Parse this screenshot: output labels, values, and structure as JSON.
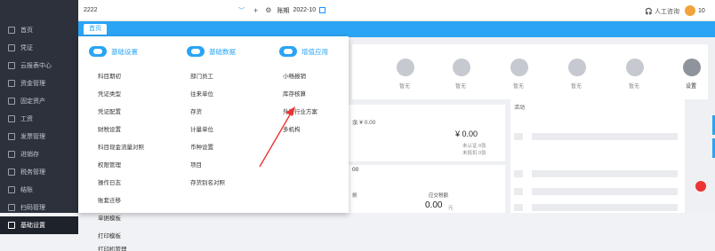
{
  "sidebar": {
    "items": [
      {
        "label": "首页"
      },
      {
        "label": "凭证"
      },
      {
        "label": "云报表中心"
      },
      {
        "label": "资金管理"
      },
      {
        "label": "固定资产"
      },
      {
        "label": "工资"
      },
      {
        "label": "发票管理"
      },
      {
        "label": "进销存"
      },
      {
        "label": "税务管理"
      },
      {
        "label": "结账"
      },
      {
        "label": "扫码管理"
      },
      {
        "label": "基础设置"
      }
    ]
  },
  "topbar": {
    "company": "2222",
    "period_label": "账期",
    "period_value": "2022-10",
    "support": "人工咨询",
    "user": "10"
  },
  "tabs": [
    {
      "label": "首页"
    }
  ],
  "menu": {
    "col1": {
      "title": "基础设置",
      "items": [
        "科目期初",
        "凭证类型",
        "凭证配置",
        "财税设置",
        "科目现金流量对照",
        "权限管理",
        "操作日志",
        "账套迁移",
        "单据模板",
        "打印模板",
        "打印机管理"
      ]
    },
    "col2": {
      "title": "基础数据",
      "items": [
        "部门员工",
        "往来单位",
        "存货",
        "计量单位",
        "币种设置",
        "项目",
        "存货别名对照"
      ]
    },
    "col3": {
      "title": "增值应用",
      "items": [
        "小畅报销",
        "库存核算",
        "外贸行业方案",
        "多机构"
      ]
    }
  },
  "dashboard": {
    "empty_label": "暂无",
    "settings_label": "设置",
    "activity_label": "活动",
    "balance_prefix": "余 ¥ 0.00",
    "amount": "¥ 0.00",
    "unverified": "未认证  0张",
    "unsigned": "未抵扣  0张",
    "hundreds": "00",
    "bottom_left_small": "损",
    "bottom_title": "应交税额",
    "bottom_value": "0.00",
    "bottom_unit": "元"
  },
  "colors": {
    "sidebar_bg": "#2c313b",
    "accent": "#2aa4f4",
    "arrow": "#e33"
  }
}
